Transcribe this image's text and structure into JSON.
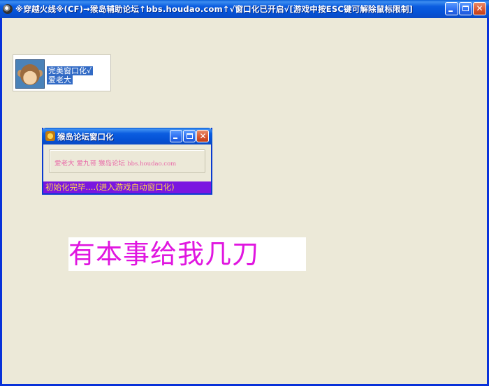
{
  "window": {
    "title": "※穿越火线※(CF)→猴岛辅助论坛↑bbs.houdao.com↑√窗口化已开启√[游戏中按ESC键可解除鼠标限制]",
    "icon": "crossfire-app-icon"
  },
  "profile": {
    "line1": "完美窗口化√",
    "line2": "爱老大",
    "avatar_icon": "monkey-avatar-icon"
  },
  "inner_window": {
    "title": "猴岛论坛窗口化",
    "icon": "houdao-icon",
    "credits": {
      "names": "爱老大 爱九哥 猴岛论坛",
      "url": "bbs.houdao.com"
    },
    "status": "初始化完毕....(进入游戏自动窗口化)"
  },
  "banner": {
    "text": "有本事给我几刀"
  },
  "colors": {
    "titlebar": "#0552d6",
    "desktop": "#ece9d8",
    "status_bg": "#7a16e0",
    "status_text": "#ffd84a",
    "credits_text": "#e86aa8",
    "banner_text": "#e016e0"
  }
}
